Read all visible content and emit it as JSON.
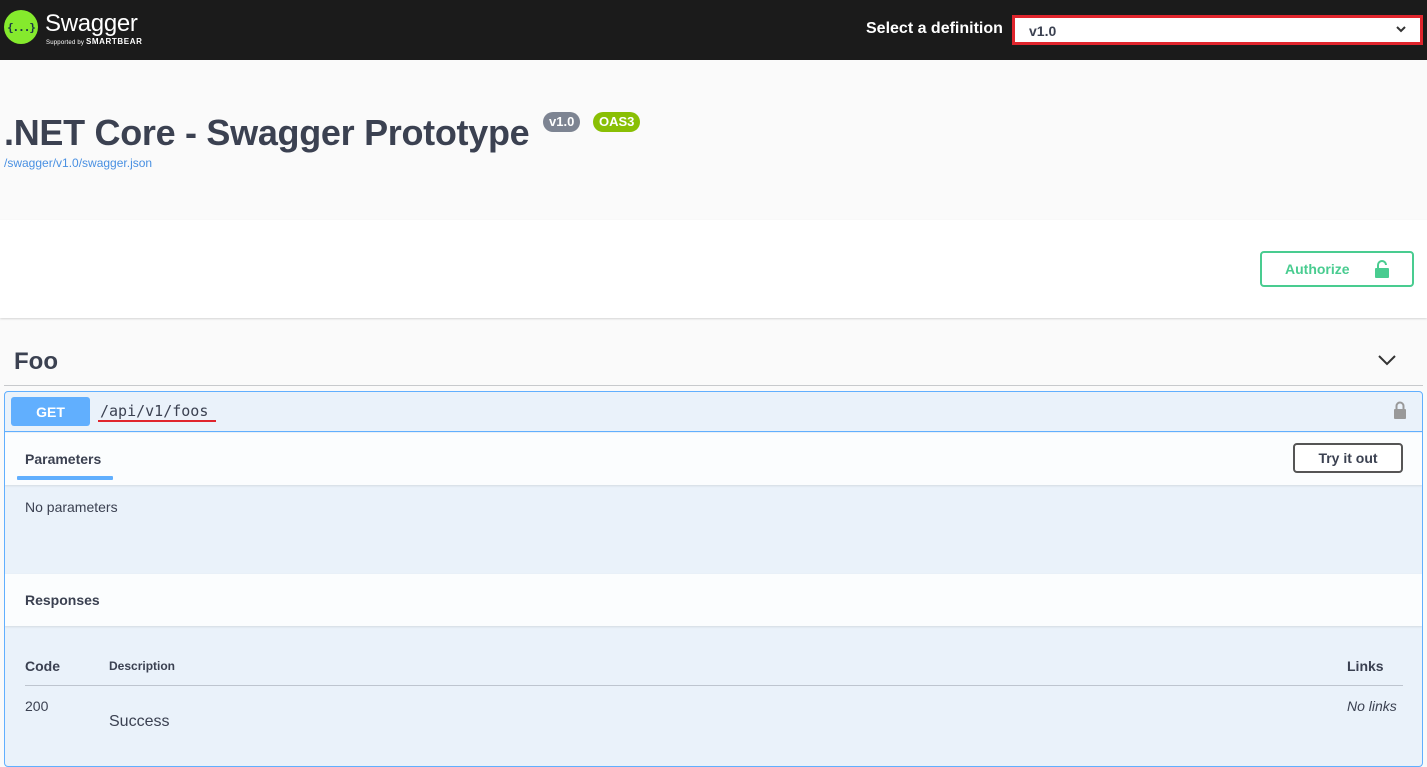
{
  "topbar": {
    "logo_name": "Swagger",
    "logo_sub_prefix": "Supported by",
    "logo_sub_brand": "SMARTBEAR",
    "logo_glyph": "{...}",
    "definition_label": "Select a definition",
    "definition_value": "v1.0"
  },
  "info": {
    "title": ".NET Core - Swagger Prototype",
    "version_badge": "v1.0",
    "oas_badge": "OAS3",
    "spec_url": "/swagger/v1.0/swagger.json"
  },
  "auth": {
    "authorize_label": "Authorize"
  },
  "tag": {
    "name": "Foo"
  },
  "operation": {
    "method": "GET",
    "path": "/api/v1/foos",
    "parameters_tab": "Parameters",
    "try_button": "Try it out",
    "no_parameters": "No parameters",
    "responses_title": "Responses",
    "columns": {
      "code": "Code",
      "description": "Description",
      "links": "Links"
    },
    "responses": [
      {
        "code": "200",
        "description": "Success",
        "links": "No links"
      }
    ]
  },
  "colors": {
    "topbar": "#1b1b1b",
    "logo_green": "#85ea2d",
    "get_blue": "#61affe",
    "authorize_green": "#49cc90",
    "highlight_red": "#e0252d",
    "oas_badge": "#89bf04",
    "version_badge": "#7d8492"
  }
}
